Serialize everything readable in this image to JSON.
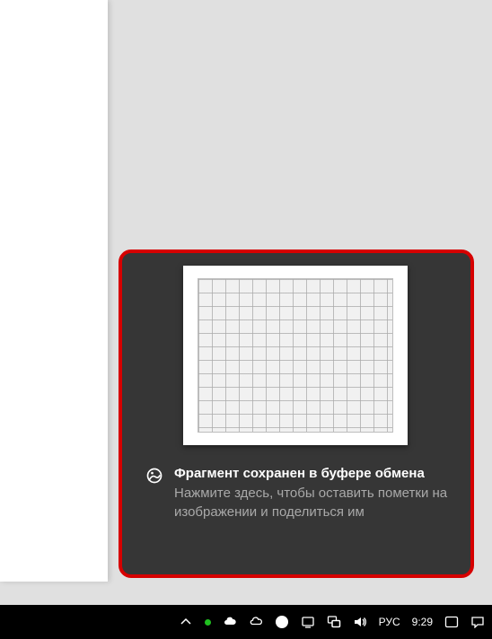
{
  "toast": {
    "title": "Фрагмент сохранен в буфере обмена",
    "body": "Нажмите здесь, чтобы оставить пометки на изображении и поделиться им"
  },
  "taskbar": {
    "lang": "РУС",
    "clock": "9:29"
  }
}
